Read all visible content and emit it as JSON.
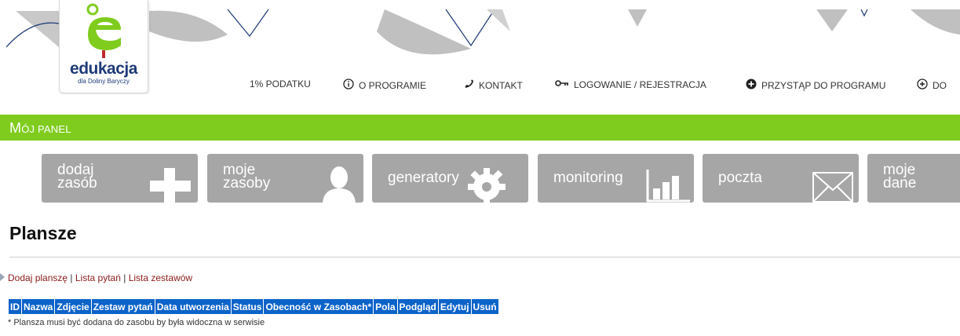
{
  "header": {
    "logo": {
      "title": "edukacja",
      "subtitle": "dla Doliny Baryczy"
    },
    "nav": [
      {
        "label": "1% PODATKU",
        "icon": ""
      },
      {
        "label": "O PROGRAMIE",
        "icon": "info-circle-icon"
      },
      {
        "label": "KONTAKT",
        "icon": "phone-icon"
      },
      {
        "label": "LOGOWANIE / REJESTRACJA",
        "icon": "key-icon"
      },
      {
        "label": "PRZYSTĄP DO PROGRAMU",
        "icon": "plus-filled-icon"
      },
      {
        "label": "DO",
        "icon": "plus-circle-icon"
      }
    ]
  },
  "panel": {
    "title_first": "M",
    "title_rest": "ój panel"
  },
  "tiles": [
    {
      "line1": "dodaj",
      "line2": "zasób",
      "icon": "plus-icon"
    },
    {
      "line1": "moje",
      "line2": "zasoby",
      "icon": "user-icon"
    },
    {
      "line1": "generatory",
      "line2": "",
      "icon": "gear-icon"
    },
    {
      "line1": "monitoring",
      "line2": "",
      "icon": "bar-chart-icon"
    },
    {
      "line1": "poczta",
      "line2": "",
      "icon": "envelope-icon"
    },
    {
      "line1": "moje",
      "line2": "dane",
      "icon": ""
    }
  ],
  "main": {
    "title": "Plansze",
    "links": [
      "Dodaj planszę",
      "Lista pytań",
      "Lista zestawów"
    ],
    "separator": " | ",
    "table_headers": [
      "ID",
      "Nazwa",
      "Zdjęcie",
      "Zestaw pytań",
      "Data utworzenia",
      "Status",
      "Obecność w Zasobach*",
      "Pola",
      "Podgląd",
      "Edytuj",
      "Usuń"
    ],
    "note": "* Plansza musi być dodana do zasobu by była widoczna w serwisie"
  },
  "colors": {
    "green_bar": "#7fcc1e",
    "tile": "#a6a6a6",
    "table_header": "#0c63c9",
    "link": "#8b1a1a"
  }
}
